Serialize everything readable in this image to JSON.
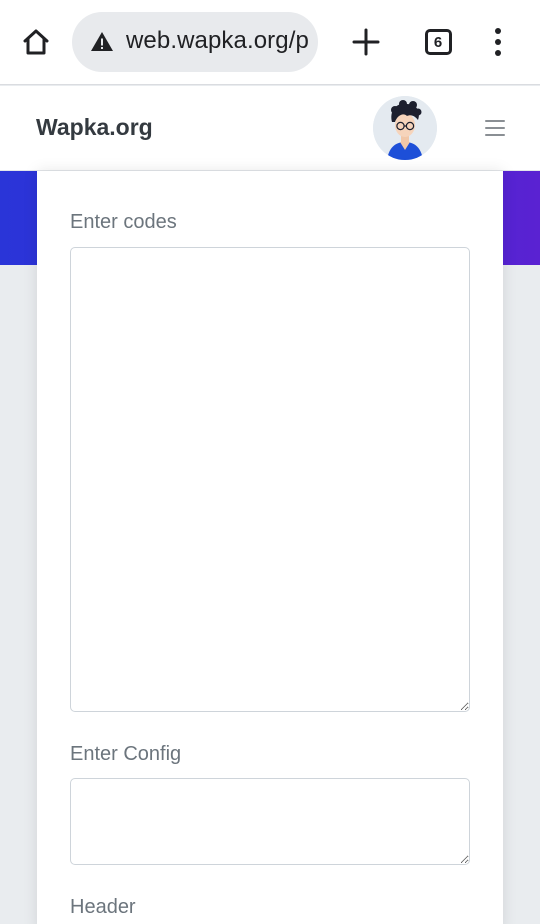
{
  "browser": {
    "url": "web.wapka.org/p",
    "tab_count": "6",
    "icons": [
      "home-icon",
      "not-secure-warning-icon",
      "new-tab-plus-icon",
      "tab-switcher-icon",
      "more-vert-icon"
    ]
  },
  "site": {
    "brand": "Wapka.org",
    "colors": {
      "band_start": "#2a35d8",
      "band_end": "#5a22d2",
      "label": "#6c757d",
      "brand": "#343a40"
    }
  },
  "form": {
    "codes_label": "Enter codes",
    "codes_value": "",
    "config_label": "Enter Config",
    "config_value": "",
    "header_label": "Header"
  }
}
